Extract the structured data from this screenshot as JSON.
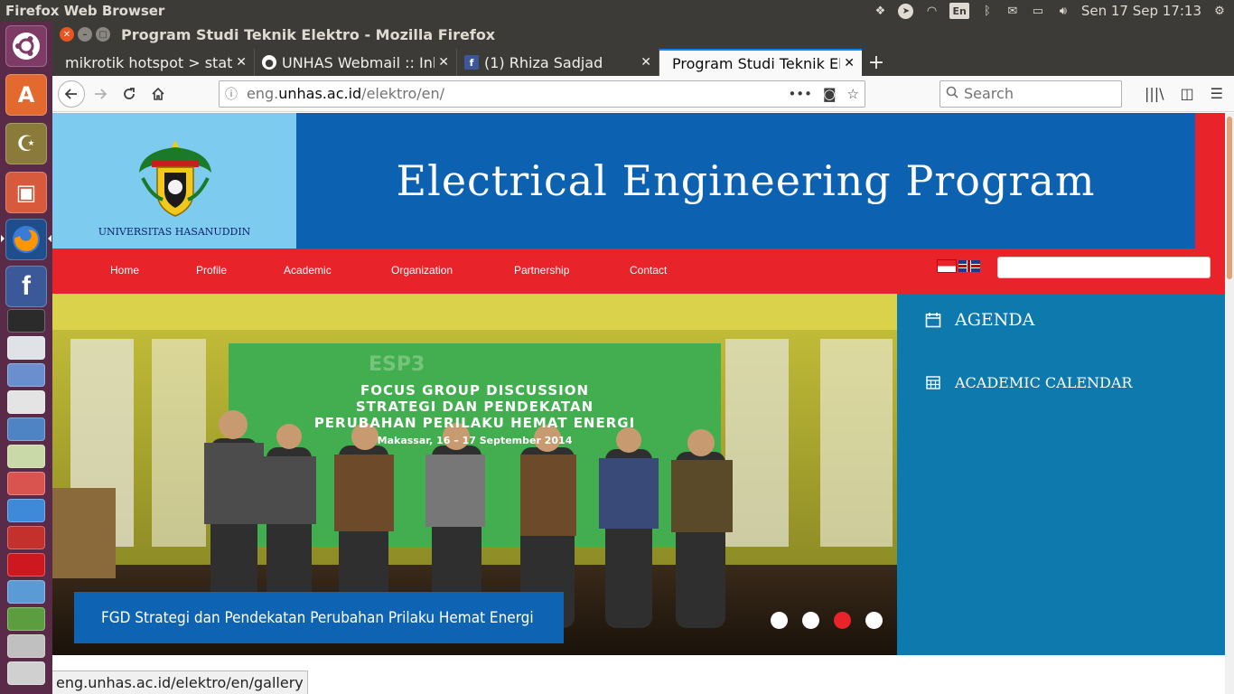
{
  "top_panel": {
    "app_name": "Firefox Web Browser",
    "keyboard_layout": "En",
    "clock": "Sen 17 Sep 17:13"
  },
  "window": {
    "title": "Program Studi Teknik Elektro - Mozilla Firefox"
  },
  "tabs": [
    {
      "label": "mikrotik hotspot > status",
      "favicon": "",
      "active": false
    },
    {
      "label": "UNHAS Webmail :: Inbox",
      "favicon": "webmail-icon",
      "active": false
    },
    {
      "label": "(1) Rhiza Sadjad",
      "favicon": "facebook-icon",
      "active": false
    },
    {
      "label": "Program Studi Teknik Elektro",
      "favicon": "",
      "active": true
    }
  ],
  "navbar": {
    "url_prefix": "eng.",
    "url_host": "unhas.ac.id",
    "url_path": "/elektro/en/",
    "search_placeholder": "Search"
  },
  "site": {
    "university_name": "UNIVERSITAS HASANUDDIN",
    "title": "Electrical Engineering Program",
    "menu": [
      "Home",
      "Profile",
      "Academic",
      "Organization",
      "Partnership",
      "Contact"
    ],
    "search_value": ""
  },
  "slider": {
    "banner_line1": "FOCUS GROUP DISCUSSION",
    "banner_line2": "STRATEGI DAN PENDEKATAN",
    "banner_line3": "PERUBAHAN PERILAKU HEMAT ENERGI",
    "banner_line4": "Makassar, 16 – 17 September 2014",
    "banner_logo": "ESP3",
    "caption": "FGD Strategi dan Pendekatan Perubahan Prilaku Hemat Energi",
    "dot_count": 4,
    "active_dot": 3
  },
  "sidebar": {
    "agenda": "AGENDA",
    "academic_calendar": "ACADEMIC CALENDAR"
  },
  "status_url": "eng.unhas.ac.id/elektro/en/gallery",
  "colors": {
    "site_red": "#e8232a",
    "site_blue": "#0c62b0",
    "sidebar_blue": "#0e79ad",
    "logo_bg": "#7ecbf0",
    "ubuntu_orange": "#e95420"
  }
}
